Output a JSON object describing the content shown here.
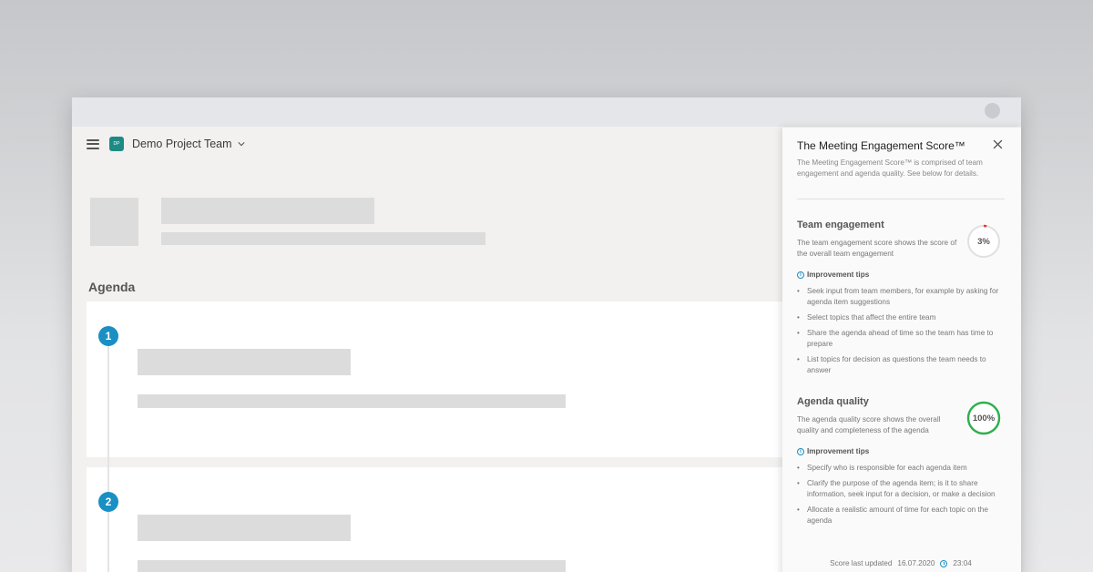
{
  "header": {
    "team_badge": "DP",
    "team_name": "Demo Project Team"
  },
  "agenda": {
    "title": "Agenda",
    "items": [
      {
        "number": "1"
      },
      {
        "number": "2"
      }
    ]
  },
  "panel": {
    "title": "The Meeting Engagement Score™",
    "description": "The Meeting Engagement Score™ is comprised of team engagement and agenda quality. See below for details.",
    "team_engagement": {
      "title": "Team engagement",
      "description": "The team engagement score shows the score of the overall team engagement",
      "score_label": "3%",
      "score_fraction": 0.03,
      "ring_color": "#e53935",
      "tips_title": "Improvement tips",
      "tips": [
        "Seek input from team members, for example by asking for agenda item suggestions",
        "Select topics that affect the entire team",
        "Share the agenda ahead of time so the team has time to prepare",
        "List topics for decision as questions the team needs to answer"
      ]
    },
    "agenda_quality": {
      "title": "Agenda quality",
      "description": "The agenda quality score shows the overall quality and completeness of the agenda",
      "score_label": "100%",
      "score_fraction": 1.0,
      "ring_color": "#2eaf4d",
      "tips_title": "Improvement tips",
      "tips": [
        "Specify who is responsible for each agenda item",
        "Clarify the purpose of the agenda item; is it to share information, seek input for a decision, or make a decision",
        "Allocate a realistic amount of time for each topic on the agenda"
      ]
    },
    "footer": {
      "label": "Score last updated",
      "date": "16.07.2020",
      "time": "23:04"
    }
  },
  "colors": {
    "accent": "#1a8fc4",
    "team_badge": "#1e8a84"
  }
}
